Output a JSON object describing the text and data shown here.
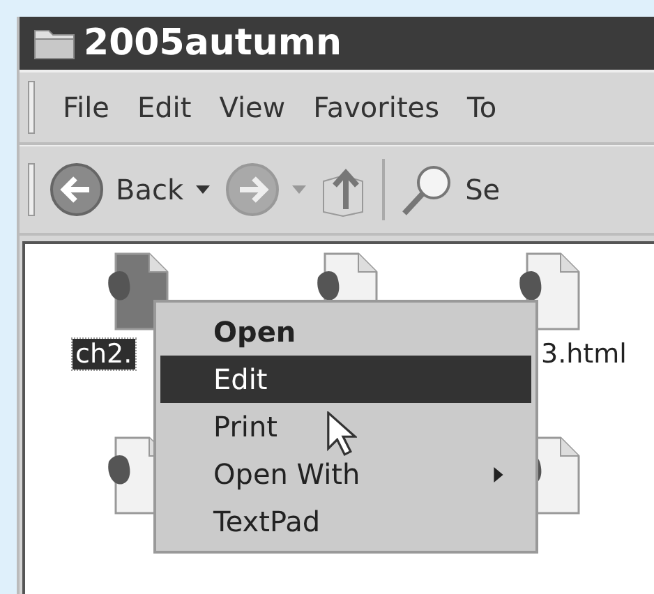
{
  "window": {
    "title": "2005autumn"
  },
  "menu_bar": [
    {
      "label": "File"
    },
    {
      "label": "Edit"
    },
    {
      "label": "View"
    },
    {
      "label": "Favorites"
    },
    {
      "label": "To"
    }
  ],
  "toolbar": [
    {
      "kind": "back",
      "label": "Back"
    },
    {
      "kind": "forward"
    },
    {
      "kind": "up"
    },
    {
      "kind": "search",
      "label": "Se"
    }
  ],
  "files": [
    {
      "label": "ch2.",
      "selected": true
    },
    {
      "selected": false
    },
    {
      "label": "3.html",
      "selected": false
    },
    {
      "selected": false
    },
    {
      "selected": false
    }
  ],
  "context_menu": [
    {
      "label": "Open",
      "default": true,
      "selected": false,
      "submenu": false
    },
    {
      "label": "Edit",
      "default": false,
      "selected": true,
      "submenu": false
    },
    {
      "label": "Print",
      "default": false,
      "selected": false,
      "submenu": false
    },
    {
      "label": "Open With",
      "default": false,
      "selected": false,
      "submenu": true
    },
    {
      "label": "TextPad",
      "default": false,
      "selected": false,
      "submenu": false
    }
  ]
}
